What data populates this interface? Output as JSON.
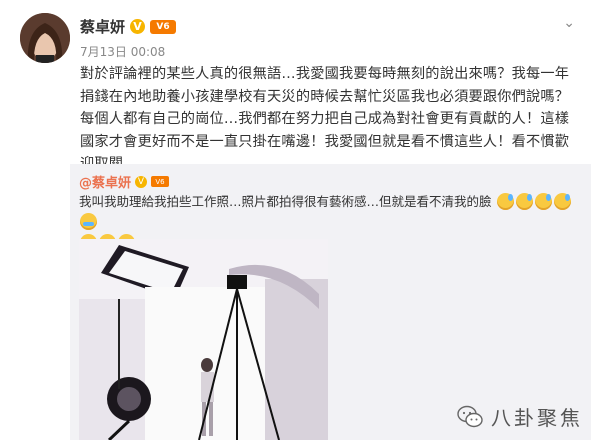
{
  "post": {
    "author": "蔡卓妍",
    "time": "7月13日 00:08",
    "text": "對於評論裡的某些人真的很無語…我愛國我要每時無刻的說出來嗎？我每一年捐錢在內地助養小孩建學校有天災的時候去幫忙災區我也必須要跟你們說嗎？每個人都有自己的崗位…我們都在努力把自己成為對社會更有貢獻的人！這樣國家才會更好而不是一直只掛在嘴邊！我愛國但就是看不慣這些人！看不慣歡迎取關"
  },
  "repost": {
    "author": "@蔡卓妍",
    "text": "我叫我助理給我拍些工作照…照片都拍得很有藝術感…但就是看不清我的臉"
  },
  "icons": {
    "verified": "verified-badge-icon",
    "vip": "vip-badge-icon",
    "more": "chevron-down-icon",
    "emoticon_sweat": "sweat-emoticon-icon",
    "emoticon_cry": "laugh-cry-emoticon-icon"
  },
  "watermark": {
    "text": "八卦聚焦"
  },
  "colors": {
    "repost_bg": "#f2f2f5",
    "author_link": "#eb7350",
    "verified": "#f7b500"
  }
}
